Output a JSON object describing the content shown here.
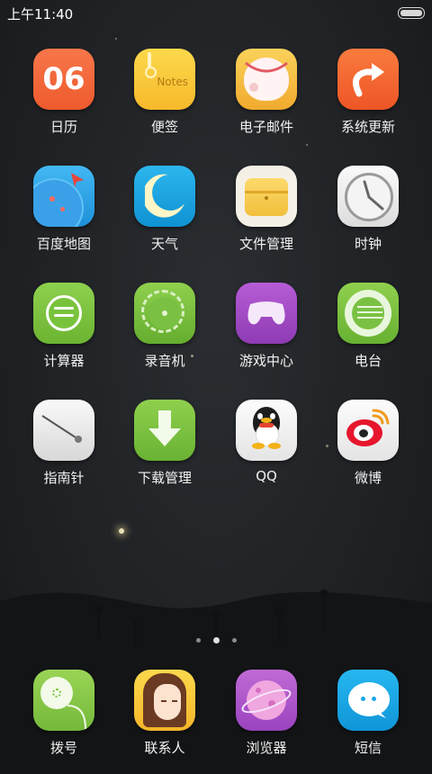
{
  "status_bar": {
    "time": "上午11:40"
  },
  "home": {
    "apps": [
      {
        "label": "日历",
        "icon": "calendar-icon",
        "text": "06"
      },
      {
        "label": "便签",
        "icon": "notes-icon",
        "text": "Notes"
      },
      {
        "label": "电子邮件",
        "icon": "email-icon"
      },
      {
        "label": "系统更新",
        "icon": "system-update-icon"
      },
      {
        "label": "百度地图",
        "icon": "baidu-map-icon"
      },
      {
        "label": "天气",
        "icon": "weather-icon"
      },
      {
        "label": "文件管理",
        "icon": "file-manager-icon"
      },
      {
        "label": "时钟",
        "icon": "clock-icon"
      },
      {
        "label": "计算器",
        "icon": "calculator-icon"
      },
      {
        "label": "录音机",
        "icon": "recorder-icon"
      },
      {
        "label": "游戏中心",
        "icon": "game-center-icon"
      },
      {
        "label": "电台",
        "icon": "radio-icon"
      },
      {
        "label": "指南针",
        "icon": "compass-icon"
      },
      {
        "label": "下载管理",
        "icon": "download-manager-icon"
      },
      {
        "label": "QQ",
        "icon": "qq-icon"
      },
      {
        "label": "微博",
        "icon": "weibo-icon"
      }
    ],
    "pages": {
      "count": 3,
      "current": 2
    }
  },
  "dock": {
    "apps": [
      {
        "label": "拨号",
        "icon": "dialer-icon"
      },
      {
        "label": "联系人",
        "icon": "contacts-icon"
      },
      {
        "label": "浏览器",
        "icon": "browser-icon"
      },
      {
        "label": "短信",
        "icon": "messages-icon"
      }
    ]
  },
  "colors": {
    "background": "#1d1f22",
    "calendar": "#f2653a",
    "notes": "#f9c93a",
    "update": "#f36a32",
    "map": "#2ea5e6",
    "weather": "#17a6e0",
    "files": "#f3c855",
    "green": "#7ac143",
    "game": "#a44cc4",
    "dialer": "#8cc63f",
    "browser": "#b25ac8",
    "messages": "#1ba8e6"
  }
}
